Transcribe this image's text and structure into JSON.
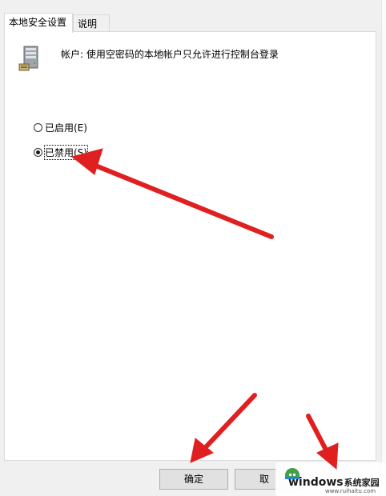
{
  "tabs": [
    {
      "label": "本地安全设置",
      "active": true
    },
    {
      "label": "说明",
      "active": false
    }
  ],
  "policy": {
    "icon": "server-icon",
    "title": "帐户: 使用空密码的本地帐户只允许进行控制台登录"
  },
  "options": [
    {
      "label": "已启用(E)",
      "checked": false
    },
    {
      "label": "已禁用(S)",
      "checked": true
    }
  ],
  "buttons": {
    "ok": "确定",
    "cancel": "取"
  },
  "watermark": {
    "title": "windows",
    "subtitle": "系统家园",
    "url": "www.ruihaitu.com"
  },
  "colors": {
    "annotation_arrow": "#e02020",
    "tab_border": "#d9d9d9",
    "panel_bg": "#ffffff",
    "dialog_bg": "#f0f0f0"
  }
}
